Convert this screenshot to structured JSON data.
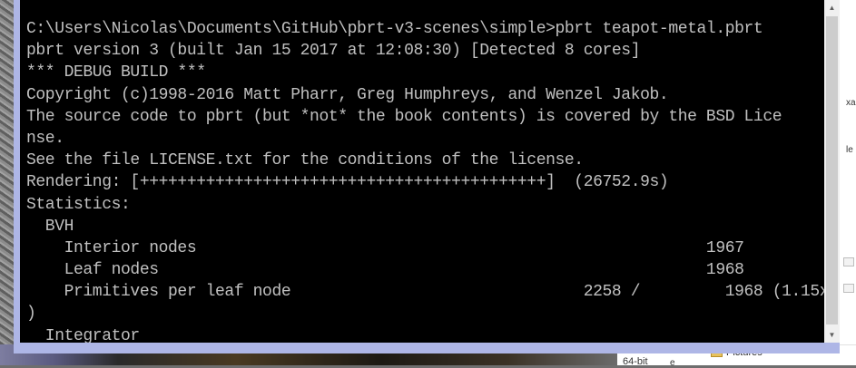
{
  "console": {
    "lines": [
      "C:\\Users\\Nicolas\\Documents\\GitHub\\pbrt-v3-scenes\\simple>pbrt teapot-metal.pbrt",
      "pbrt version 3 (built Jan 15 2017 at 12:08:30) [Detected 8 cores]",
      "*** DEBUG BUILD ***",
      "Copyright (c)1998-2016 Matt Pharr, Greg Humphreys, and Wenzel Jakob.",
      "The source code to pbrt (but *not* the book contents) is covered by the BSD Lice",
      "nse.",
      "See the file LICENSE.txt for the conditions of the license.",
      "Rendering: [+++++++++++++++++++++++++++++++++++++++++++]  (26752.9s)",
      "Statistics:",
      "  BVH",
      "    Interior nodes                                                      1967",
      "    Leaf nodes                                                          1968",
      "    Primitives per leaf node                               2258 /         1968 (1.15x",
      ")",
      "  Integrator"
    ],
    "scroll_up_icon": "triangle-up",
    "scroll_down_icon": "triangle-down"
  },
  "explorer": {
    "right_fragments": [
      "xa",
      "le"
    ],
    "pictures_label": "Pictures",
    "status_text": "64-bit",
    "status_fragment": "e"
  }
}
